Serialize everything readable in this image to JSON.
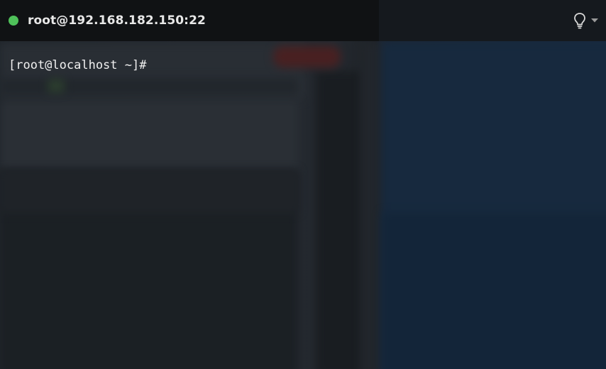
{
  "window": {
    "title": "root@192.168.182.150:22",
    "status_color": "#4fc15a",
    "connected": true
  },
  "toolbar": {
    "icons": [
      "lightbulb-icon",
      "chevron-down-icon"
    ]
  },
  "terminal": {
    "prompt": "[root@localhost ~]#"
  }
}
